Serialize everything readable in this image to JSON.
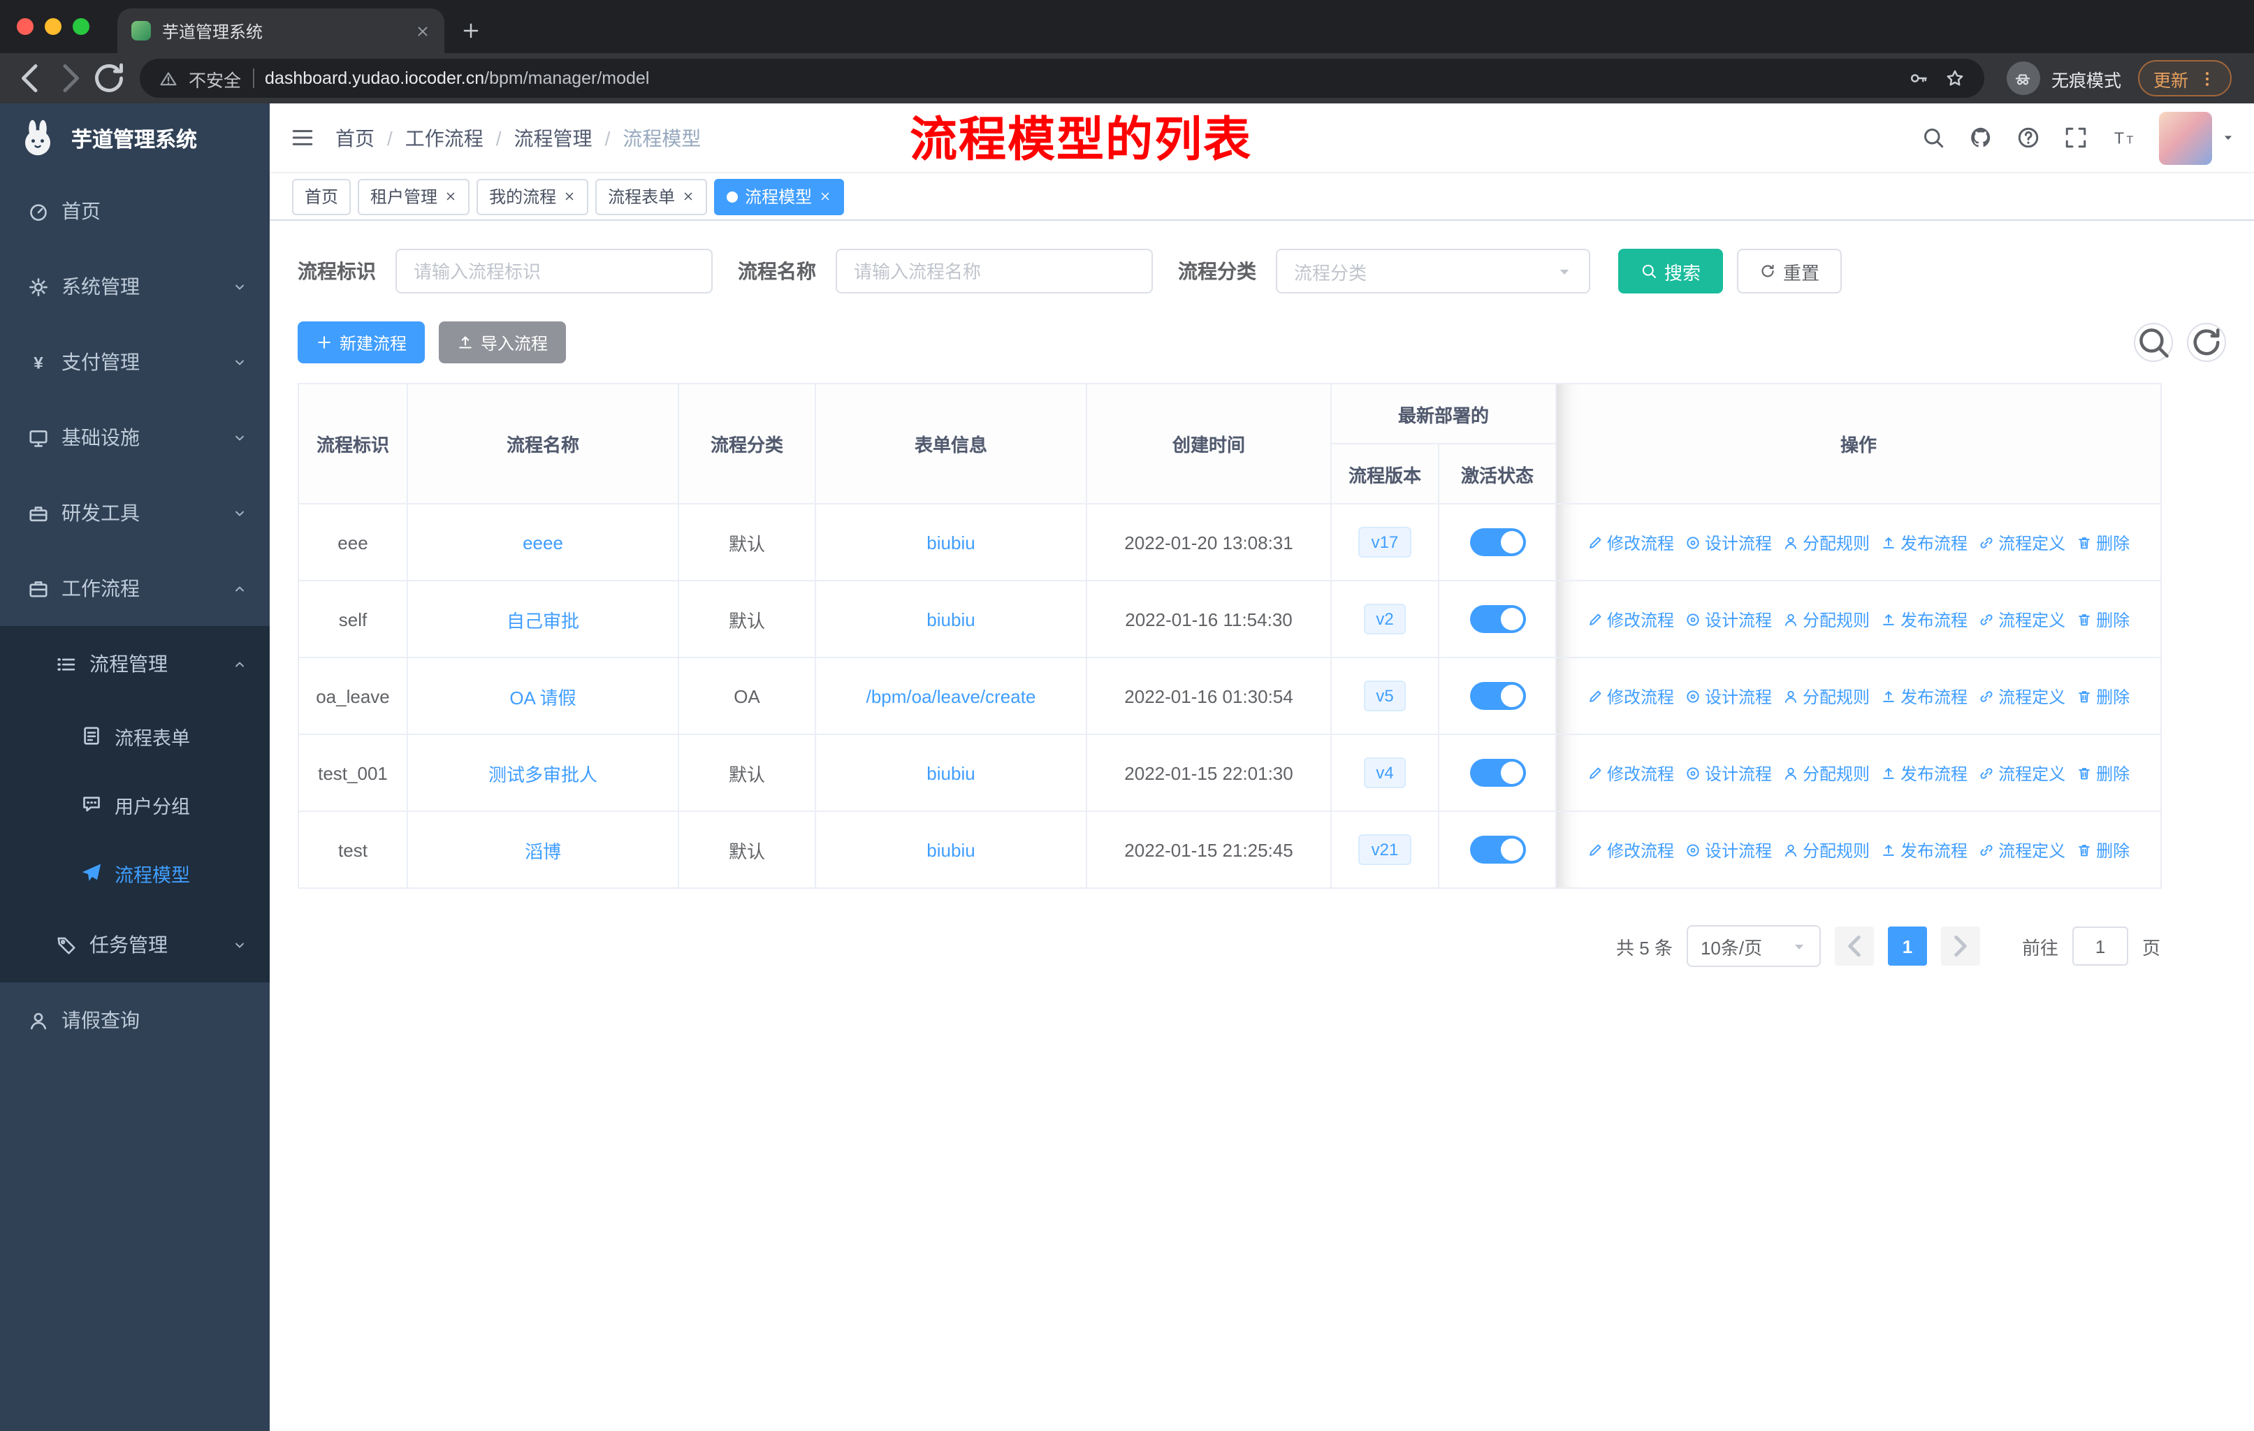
{
  "browser": {
    "tab_title": "芋道管理系统",
    "security_label": "不安全",
    "url_domain": "dashboard.yudao.iocoder.cn",
    "url_path": "/bpm/manager/model",
    "incognito_label": "无痕模式",
    "update_label": "更新"
  },
  "sidebar": {
    "logo_title": "芋道管理系统",
    "items": [
      {
        "key": "home",
        "label": "首页",
        "icon": "dashboard-icon",
        "level": 1
      },
      {
        "key": "system-manage",
        "label": "系统管理",
        "icon": "gear-icon",
        "level": 1,
        "chevron": "down"
      },
      {
        "key": "payment-manage",
        "label": "支付管理",
        "icon": "yen-icon",
        "level": 1,
        "chevron": "down"
      },
      {
        "key": "infrastructure",
        "label": "基础设施",
        "icon": "monitor-icon",
        "level": 1,
        "chevron": "down"
      },
      {
        "key": "dev-tools",
        "label": "研发工具",
        "icon": "tool-icon",
        "level": 1,
        "chevron": "down"
      },
      {
        "key": "workflow",
        "label": "工作流程",
        "icon": "briefcase-icon",
        "level": 1,
        "chevron": "up"
      },
      {
        "key": "process-manage",
        "label": "流程管理",
        "icon": "list-icon",
        "level": 2,
        "chevron": "up",
        "submenu": true
      },
      {
        "key": "process-form",
        "label": "流程表单",
        "icon": "document-icon",
        "level": 3,
        "submenu": true
      },
      {
        "key": "user-group",
        "label": "用户分组",
        "icon": "chat-icon",
        "level": 3,
        "submenu": true
      },
      {
        "key": "process-model",
        "label": "流程模型",
        "icon": "send-icon",
        "level": 3,
        "submenu": true,
        "active": true
      },
      {
        "key": "task-manage",
        "label": "任务管理",
        "icon": "tag-icon",
        "level": 2,
        "chevron": "down",
        "submenu": true
      },
      {
        "key": "leave-query",
        "label": "请假查询",
        "icon": "user-icon",
        "level": 1
      }
    ]
  },
  "navbar": {
    "breadcrumb": [
      "首页",
      "工作流程",
      "流程管理",
      "流程模型"
    ],
    "annotation": "流程模型的列表",
    "icons": [
      "search-icon",
      "github-icon",
      "help-icon",
      "fullscreen-icon",
      "font-size-icon"
    ]
  },
  "tags": [
    {
      "key": "home",
      "label": "首页",
      "closable": false,
      "active": false
    },
    {
      "key": "tenant-manage",
      "label": "租户管理",
      "closable": true,
      "active": false
    },
    {
      "key": "my-process",
      "label": "我的流程",
      "closable": true,
      "active": false
    },
    {
      "key": "process-form",
      "label": "流程表单",
      "closable": true,
      "active": false
    },
    {
      "key": "process-model",
      "label": "流程模型",
      "closable": true,
      "active": true
    }
  ],
  "filters": [
    {
      "key": "id",
      "label": "流程标识",
      "placeholder": "请输入流程标识",
      "type": "input"
    },
    {
      "key": "name",
      "label": "流程名称",
      "placeholder": "请输入流程名称",
      "type": "input"
    },
    {
      "key": "category",
      "label": "流程分类",
      "placeholder": "流程分类",
      "type": "select"
    }
  ],
  "filter_buttons": {
    "search": "搜索",
    "reset": "重置"
  },
  "toolbar": {
    "create": "新建流程",
    "import": "导入流程"
  },
  "table": {
    "headers": {
      "id": "流程标识",
      "name": "流程名称",
      "category": "流程分类",
      "form": "表单信息",
      "created": "创建时间",
      "deploy_group": "最新部署的",
      "version": "流程版本",
      "active_state": "激活状态",
      "actions": "操作"
    },
    "actions": [
      {
        "key": "modify",
        "label": "修改流程",
        "icon": "edit-icon"
      },
      {
        "key": "design",
        "label": "设计流程",
        "icon": "design-icon"
      },
      {
        "key": "assign",
        "label": "分配规则",
        "icon": "assign-icon"
      },
      {
        "key": "publish",
        "label": "发布流程",
        "icon": "publish-icon"
      },
      {
        "key": "definition",
        "label": "流程定义",
        "icon": "definition-icon"
      },
      {
        "key": "delete",
        "label": "删除",
        "icon": "delete-icon"
      }
    ],
    "rows": [
      {
        "id": "eee",
        "name": "eeee",
        "category": "默认",
        "form": "biubiu",
        "created": "2022-01-20 13:08:31",
        "version": "v17",
        "active": true
      },
      {
        "id": "self",
        "name": "自己审批",
        "category": "默认",
        "form": "biubiu",
        "created": "2022-01-16 11:54:30",
        "version": "v2",
        "active": true
      },
      {
        "id": "oa_leave",
        "name": "OA 请假",
        "category": "OA",
        "form": "/bpm/oa/leave/create",
        "created": "2022-01-16 01:30:54",
        "version": "v5",
        "active": true
      },
      {
        "id": "test_001",
        "name": "测试多审批人",
        "category": "默认",
        "form": "biubiu",
        "created": "2022-01-15 22:01:30",
        "version": "v4",
        "active": true
      },
      {
        "id": "test",
        "name": "滔博",
        "category": "默认",
        "form": "biubiu",
        "created": "2022-01-15 21:25:45",
        "version": "v21",
        "active": true
      }
    ]
  },
  "pagination": {
    "total": "共 5 条",
    "page_size": "10条/页",
    "current_page": "1",
    "goto_label": "前往",
    "goto_value": "1",
    "goto_suffix": "页"
  },
  "colors": {
    "primary": "#409eff",
    "search_button": "#1abc9c",
    "sidebar_bg": "#304156",
    "submenu_bg": "#1f2d3d",
    "annotation": "#ff0000",
    "tag_active": "#409eff"
  }
}
